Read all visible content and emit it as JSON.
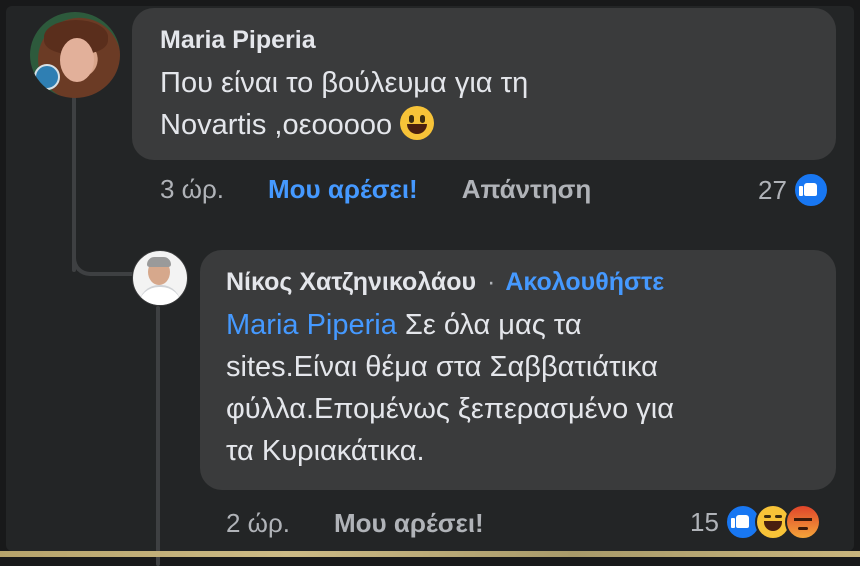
{
  "comment": {
    "author": "Maria Piperia",
    "text_line1": "Που είναι το βούλευμα για τη",
    "text_line2": "Novartis ,οεοοοοο",
    "time": "3 ώρ.",
    "like_label": "Μου αρέσει!",
    "reply_label": "Απάντηση",
    "reaction_count": "27",
    "reactions": [
      "like-icon"
    ],
    "emoji": "grinning-face-emoji"
  },
  "reply": {
    "author": "Νίκος Χατζηνικολάου",
    "separator": "·",
    "follow_label": "Ακολουθήστε",
    "mention": "Maria Piperia",
    "text_line1": "Σε όλα μας τα",
    "text_line2": "sites.Είναι θέμα στα Σαββατιάτικα",
    "text_line3": "φύλλα.Επομένως ξεπερασμένο για",
    "text_line4": "τα Κυριακάτικα.",
    "time": "2 ώρ.",
    "like_label": "Μου αρέσει!",
    "reaction_count": "15",
    "reactions": [
      "like-icon",
      "haha-icon",
      "angry-icon"
    ]
  },
  "colors": {
    "background": "#18191a",
    "bubble": "#3a3b3c",
    "link_blue": "#4599ff",
    "muted_text": "#b0b3b8"
  }
}
